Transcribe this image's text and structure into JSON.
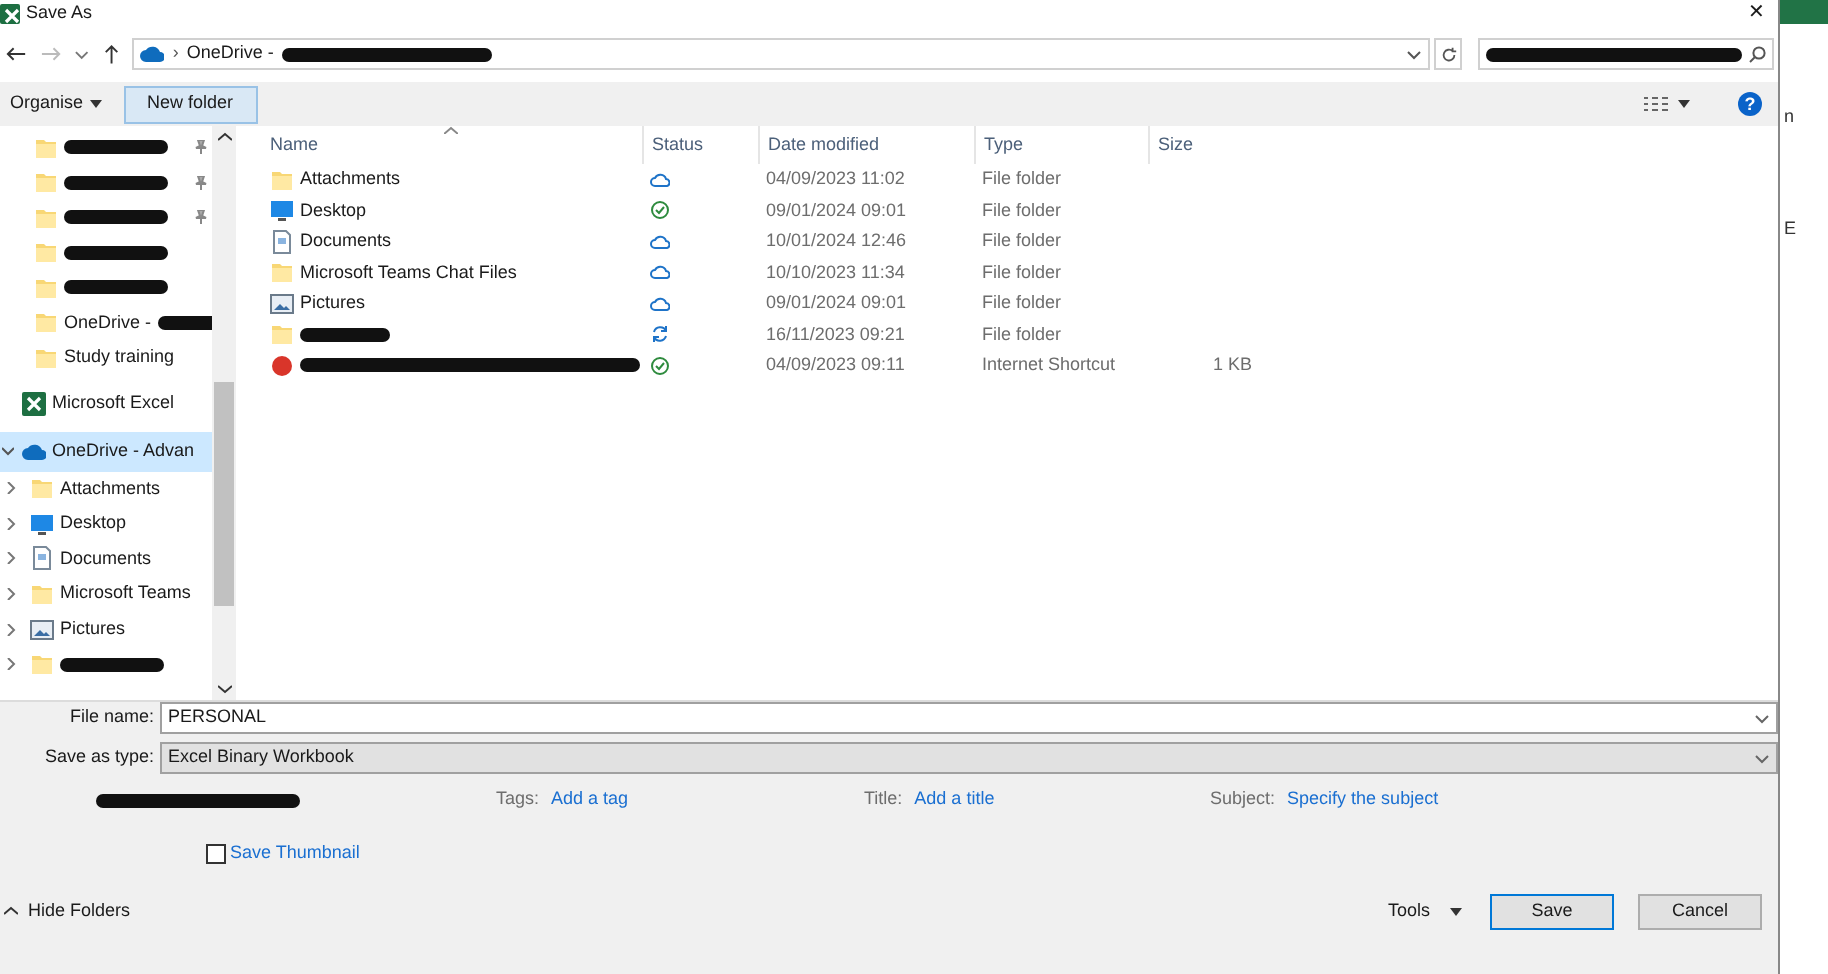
{
  "window": {
    "title": "Save As",
    "close": "✕"
  },
  "address": {
    "separator": "›",
    "path": "OneDrive -",
    "redacted": true
  },
  "search": {
    "redacted": true
  },
  "toolbar": {
    "organise": "Organise",
    "new_folder": "New folder",
    "help": "?"
  },
  "sidebar": {
    "items": [
      {
        "kind": "folder",
        "redacted": true,
        "pinned": true,
        "selected": false
      },
      {
        "kind": "folder",
        "redacted": true,
        "pinned": true,
        "selected": false
      },
      {
        "kind": "folder",
        "redacted": true,
        "pinned": true,
        "selected": false
      },
      {
        "kind": "folder",
        "redacted": true,
        "pinned": false,
        "selected": false
      },
      {
        "kind": "folder",
        "redacted": true,
        "pinned": false,
        "selected": false
      },
      {
        "kind": "folder",
        "label": "OneDrive -",
        "redacted": true,
        "pinned": false,
        "selected": false
      },
      {
        "kind": "folder",
        "label": "Study training",
        "pinned": false,
        "selected": false
      },
      {
        "kind": "excel",
        "label": "Microsoft Excel",
        "root": true,
        "pinned": false,
        "selected": false
      },
      {
        "kind": "cloud",
        "label": "OneDrive - Advan",
        "root": true,
        "expanded": true,
        "pinned": false,
        "selected": true,
        "children": [
          {
            "kind": "folder",
            "label": "Attachments",
            "expanded": false,
            "selected": false
          },
          {
            "kind": "desktop",
            "label": "Desktop",
            "expanded": false,
            "selected": false
          },
          {
            "kind": "document",
            "label": "Documents",
            "expanded": false,
            "selected": false
          },
          {
            "kind": "folder",
            "label": "Microsoft Teams",
            "expanded": false,
            "selected": false
          },
          {
            "kind": "pictures",
            "label": "Pictures",
            "expanded": false,
            "selected": false
          },
          {
            "kind": "folder",
            "redacted": true,
            "expanded": false,
            "selected": false
          }
        ]
      }
    ]
  },
  "table": {
    "columns": [
      "Name",
      "Status",
      "Date modified",
      "Type",
      "Size"
    ],
    "rows": [
      {
        "kind": "folder",
        "name": "Attachments",
        "status": {
          "kind": "cloud"
        },
        "date": "04/09/2023 11:02",
        "type": "File folder"
      },
      {
        "kind": "desktop",
        "name": "Desktop",
        "status": {
          "kind": "synced"
        },
        "date": "09/01/2024 09:01",
        "type": "File folder"
      },
      {
        "kind": "document",
        "name": "Documents",
        "status": {
          "kind": "cloud"
        },
        "date": "10/01/2024 12:46",
        "type": "File folder"
      },
      {
        "kind": "folder",
        "name": "Microsoft Teams Chat Files",
        "status": {
          "kind": "cloud"
        },
        "date": "10/10/2023 11:34",
        "type": "File folder"
      },
      {
        "kind": "pictures",
        "name": "Pictures",
        "status": {
          "kind": "cloud"
        },
        "date": "09/01/2024 09:01",
        "type": "File folder"
      },
      {
        "kind": "folder",
        "redacted": true,
        "status": {
          "kind": "syncing"
        },
        "date": "16/11/2023 09:21",
        "type": "File folder"
      },
      {
        "kind": "shortcut",
        "redacted": true,
        "status": {
          "kind": "synced"
        },
        "date": "04/09/2023 09:11",
        "type": "Internet Shortcut",
        "size": "1 KB"
      }
    ]
  },
  "form": {
    "file_name_label": "File name:",
    "file_name": "PERSONAL",
    "type_label": "Save as type:",
    "type": "Excel Binary Workbook",
    "author_redacted": true,
    "meta": [
      {
        "label": "Tags:",
        "link": "Add a tag"
      },
      {
        "label": "Title:",
        "link": "Add a title"
      },
      {
        "label": "Subject:",
        "link": "Specify the subject"
      }
    ],
    "thumbnail": {
      "label": "Save Thumbnail",
      "checked": false
    }
  },
  "footer": {
    "hide_folders": "Hide Folders",
    "tools": "Tools",
    "save": "Save",
    "cancel": "Cancel"
  },
  "background_fragments": [
    "n",
    "E"
  ]
}
